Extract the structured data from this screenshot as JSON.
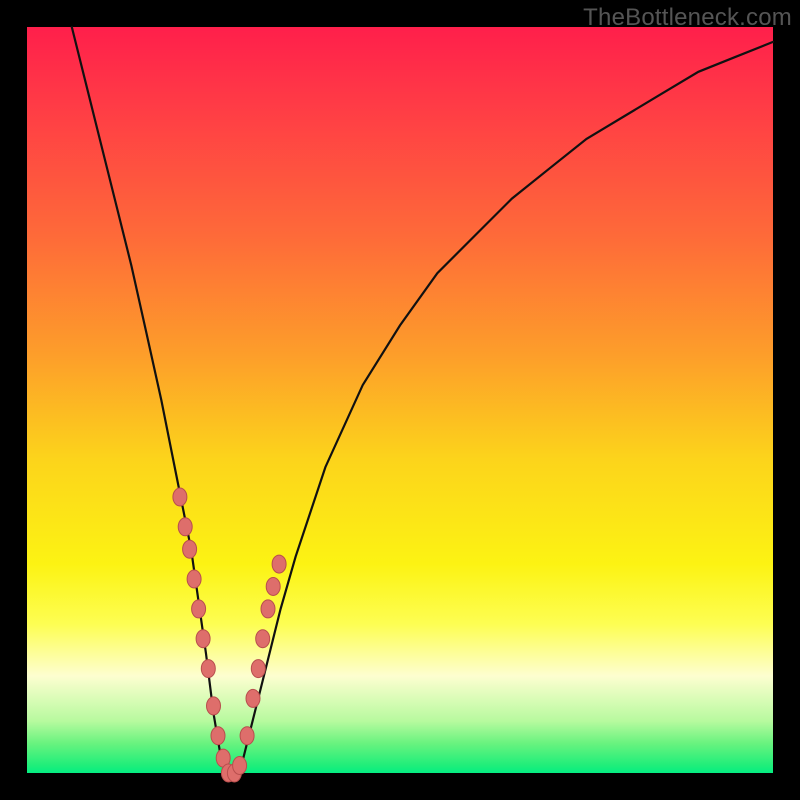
{
  "watermark": "TheBottleneck.com",
  "colors": {
    "background_frame": "#000000",
    "gradient_top": "#ff1f4b",
    "gradient_bottom": "#04ee82",
    "curve": "#111111",
    "point_fill": "#de6e6b",
    "point_stroke": "#b84e4d"
  },
  "chart_data": {
    "type": "line",
    "title": "",
    "xlabel": "",
    "ylabel": "",
    "xlim": [
      0,
      100
    ],
    "ylim": [
      0,
      100
    ],
    "grid": false,
    "legend": false,
    "series": [
      {
        "name": "bottleneck-curve",
        "comment": "V-shaped curve; y is bottleneck % (0=green/good at bottom, 100=red/bad at top). Minimum around x≈27.",
        "x": [
          6,
          8,
          10,
          12,
          14,
          16,
          18,
          20,
          22,
          24,
          25,
          26,
          27,
          28,
          29,
          30,
          32,
          34,
          36,
          40,
          45,
          50,
          55,
          60,
          65,
          70,
          75,
          80,
          85,
          90,
          95,
          100
        ],
        "y": [
          100,
          92,
          84,
          76,
          68,
          59,
          50,
          40,
          30,
          16,
          8,
          2,
          0,
          0,
          2,
          6,
          14,
          22,
          29,
          41,
          52,
          60,
          67,
          72,
          77,
          81,
          85,
          88,
          91,
          94,
          96,
          98
        ]
      }
    ],
    "points": {
      "comment": "Highlighted sample points (pink dots) clustered near the valley on both arms.",
      "x": [
        20.5,
        21.2,
        21.8,
        22.4,
        23.0,
        23.6,
        24.3,
        25.0,
        25.6,
        26.3,
        27.0,
        27.8,
        28.5,
        29.5,
        30.3,
        31.0,
        31.6,
        32.3,
        33.0,
        33.8
      ],
      "y": [
        37,
        33,
        30,
        26,
        22,
        18,
        14,
        9,
        5,
        2,
        0,
        0,
        1,
        5,
        10,
        14,
        18,
        22,
        25,
        28
      ]
    }
  }
}
